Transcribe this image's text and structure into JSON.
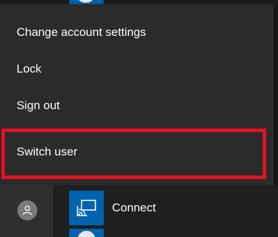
{
  "account_menu": {
    "items": [
      {
        "label": "Change account settings"
      },
      {
        "label": "Lock"
      },
      {
        "label": "Sign out"
      },
      {
        "label": "Switch user"
      }
    ]
  },
  "start_menu": {
    "user_button_icon": "user-avatar-icon",
    "apps": [
      {
        "label": "Connect",
        "icon": "connect-icon",
        "tile_color": "#0063b1"
      }
    ]
  },
  "colors": {
    "menu_background": "#2b2b2b",
    "highlight_border": "#e81123",
    "tile_blue": "#0063b1"
  }
}
